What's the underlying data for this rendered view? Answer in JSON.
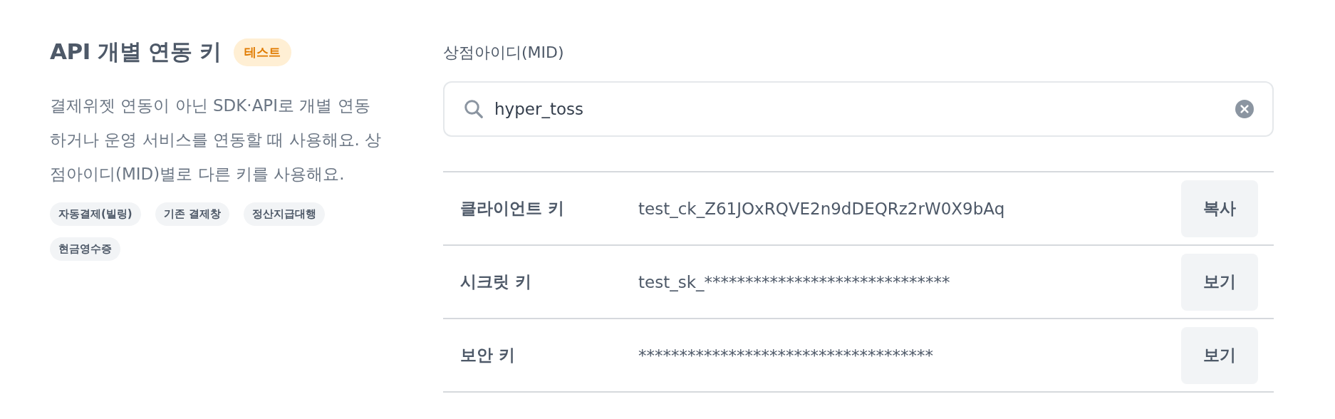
{
  "section": {
    "title": "API 개별 연동 키",
    "badge": "테스트",
    "description": "결제위젯 연동이 아닌 SDK·API로 개별 연동하거나 운영 서비스를 연동할 때 사용해요. 상점아이디(MID)별로 다른 키를 사용해요.",
    "tags": [
      "자동결제(빌링)",
      "기존 결제창",
      "정산지급대행",
      "현금영수증"
    ]
  },
  "mid": {
    "label": "상점아이디(MID)",
    "value": "hyper_toss"
  },
  "keys": [
    {
      "label": "클라이언트 키",
      "value": "test_ck_Z61JOxRQVE2n9dDEQRz2rW0X9bAq",
      "action": "복사"
    },
    {
      "label": "시크릿 키",
      "value": "test_sk_******************************",
      "action": "보기"
    },
    {
      "label": "보안 키",
      "value": "************************************",
      "action": "보기"
    }
  ]
}
